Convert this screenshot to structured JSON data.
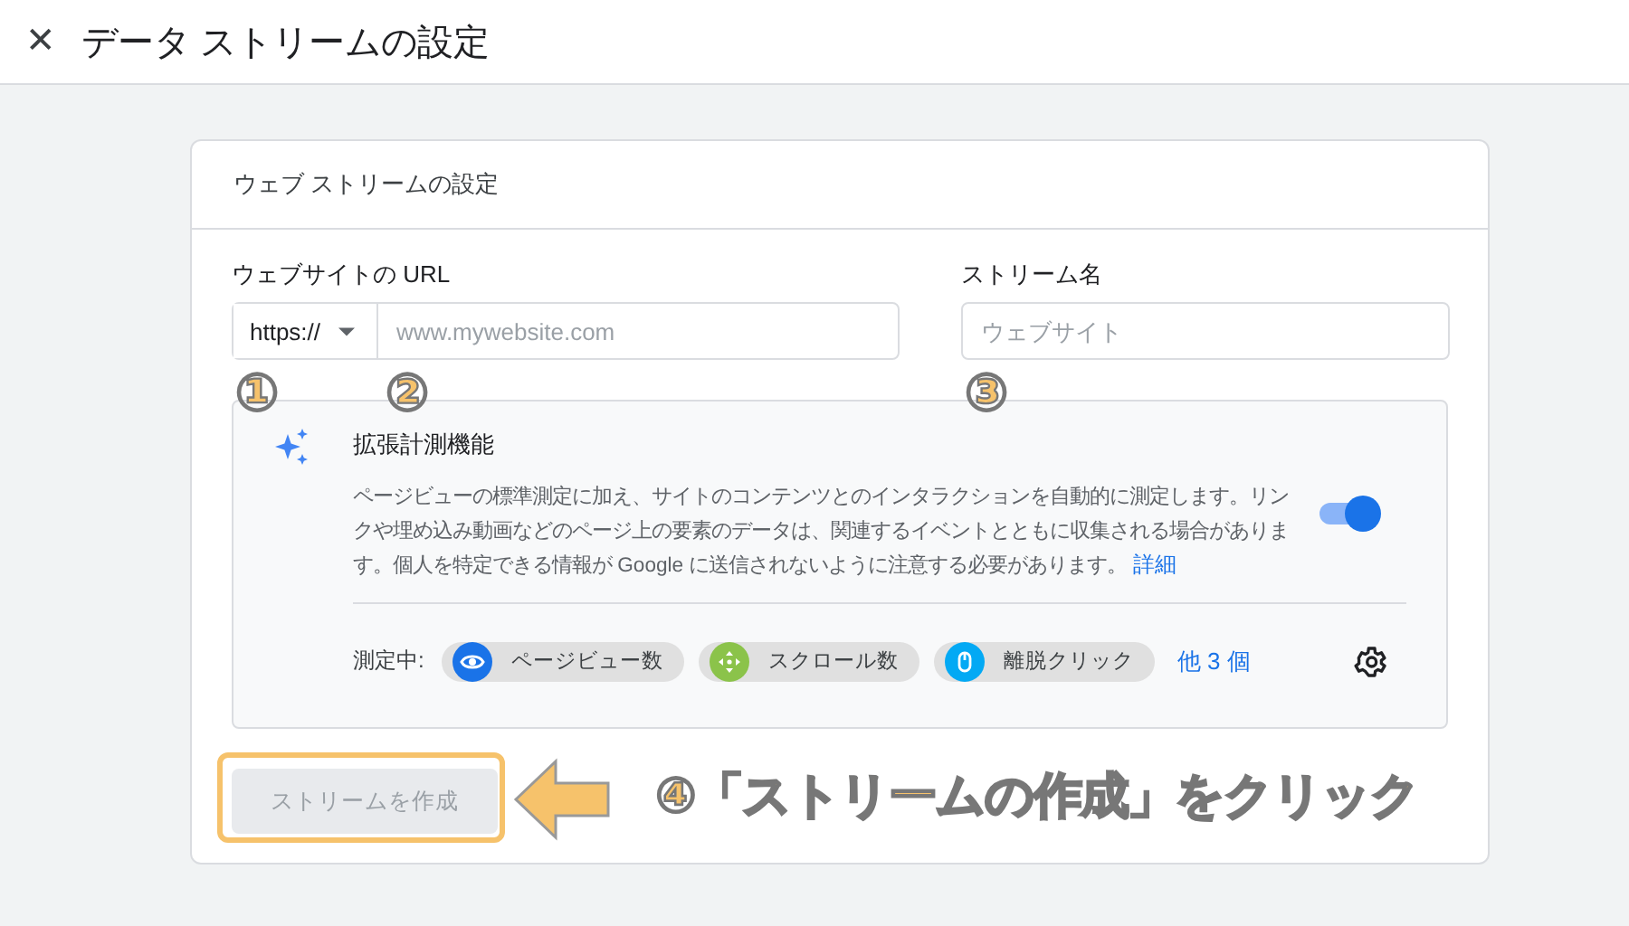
{
  "header": {
    "close_icon": "✕",
    "title": "データ ストリームの設定"
  },
  "card": {
    "title": "ウェブ ストリームの設定",
    "url_label": "ウェブサイトの URL",
    "protocol": "https://",
    "url_field": {
      "placeholder": "www.mywebsite.com"
    },
    "name_label": "ストリーム名",
    "name_field": {
      "placeholder": "ウェブサイト"
    },
    "enhanced": {
      "title": "拡張計測機能",
      "description": "ページビューの標準測定に加え、サイトのコンテンツとのインタラクションを自動的に測定します。リンクや埋め込み動画などのページ上の要素のデータは、関連するイベントとともに収集される場合があります。個人を特定できる情報が Google に送信されないように注意する必要があります。",
      "link": "詳細",
      "on": true,
      "measuring_label": "測定中:",
      "chips": [
        {
          "kind": "eye",
          "label": "ページビュー数",
          "color": "#1a73e8"
        },
        {
          "kind": "scroll",
          "label": "スクロール数",
          "color": "#8bc34a"
        },
        {
          "kind": "mouse",
          "label": "離脱クリック",
          "color": "#03a9f4"
        }
      ],
      "more": "他 3 個"
    },
    "create_button": {
      "label": "ストリームを作成",
      "disabled": true
    }
  },
  "annotations": {
    "markers": [
      "①",
      "②",
      "③"
    ],
    "caption": "④「ストリームの作成」をクリック"
  }
}
